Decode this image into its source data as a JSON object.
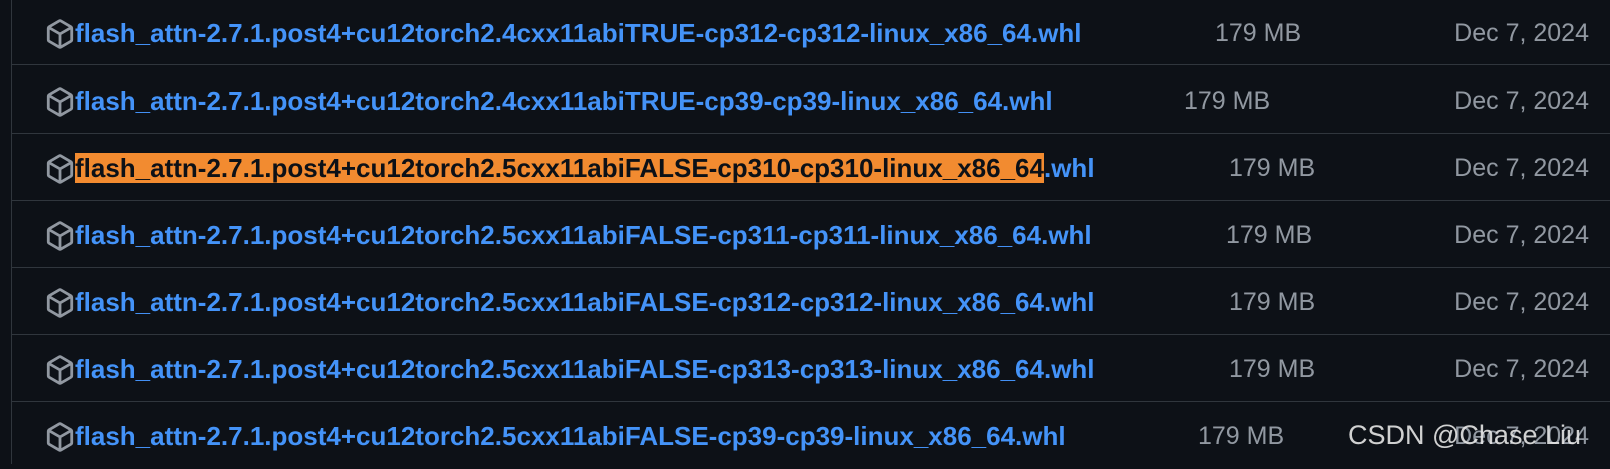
{
  "assets": [
    {
      "name": "flash_attn-2.7.1.post4+cu12torch2.4cxx11abiTRUE-cp312-cp312-linux_x86_64.whl",
      "size": "179 MB",
      "date": "Dec 7, 2024"
    },
    {
      "name": "flash_attn-2.7.1.post4+cu12torch2.4cxx11abiTRUE-cp39-cp39-linux_x86_64.whl",
      "size": "179 MB",
      "date": "Dec 7, 2024"
    },
    {
      "name": "flash_attn-2.7.1.post4+cu12torch2.5cxx11abiFALSE-cp310-cp310-linux_x86_64.whl",
      "name_highlight": "flash_attn-2.7.1.post4+cu12torch2.5cxx11abiFALSE-cp310-cp310-linux_x86_64",
      "name_rest": ".whl",
      "size": "179 MB",
      "date": "Dec 7, 2024"
    },
    {
      "name": "flash_attn-2.7.1.post4+cu12torch2.5cxx11abiFALSE-cp311-cp311-linux_x86_64.whl",
      "size": "179 MB",
      "date": "Dec 7, 2024"
    },
    {
      "name": "flash_attn-2.7.1.post4+cu12torch2.5cxx11abiFALSE-cp312-cp312-linux_x86_64.whl",
      "size": "179 MB",
      "date": "Dec 7, 2024"
    },
    {
      "name": "flash_attn-2.7.1.post4+cu12torch2.5cxx11abiFALSE-cp313-cp313-linux_x86_64.whl",
      "size": "179 MB",
      "date": "Dec 7, 2024"
    },
    {
      "name": "flash_attn-2.7.1.post4+cu12torch2.5cxx11abiFALSE-cp39-cp39-linux_x86_64.whl",
      "size": "179 MB",
      "date": "Dec 7, 2024"
    }
  ],
  "watermark": "CSDN @Chase Liu",
  "colors": {
    "background": "#0d1117",
    "link": "#4493f8",
    "muted": "#9198a1",
    "border": "#30363d",
    "highlight": "#f28b30"
  }
}
